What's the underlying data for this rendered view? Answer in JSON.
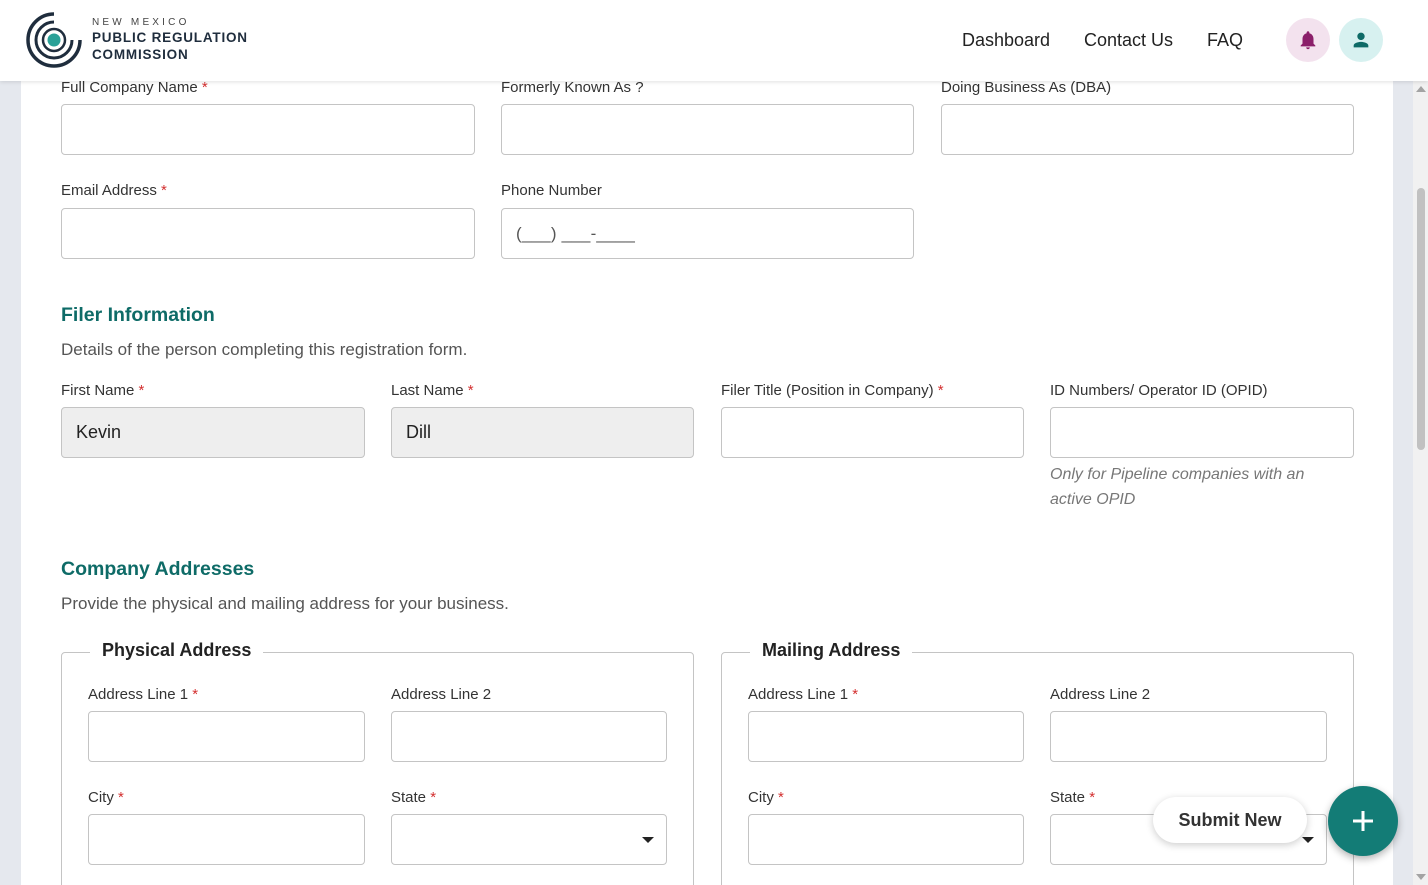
{
  "header": {
    "logo": {
      "line1": "NEW MEXICO",
      "line2": "PUBLIC REGULATION",
      "line3": "COMMISSION"
    },
    "nav": [
      "Dashboard",
      "Contact Us",
      "FAQ"
    ],
    "icons": {
      "bell": "bell-icon",
      "user": "user-icon"
    }
  },
  "company": {
    "full_name_label": "Full Company Name",
    "fka_label": "Formerly Known As ?",
    "dba_label": "Doing Business As (DBA)",
    "email_label": "Email Address",
    "phone_label": "Phone Number",
    "phone_mask": "(___) ___-____"
  },
  "filer": {
    "title": "Filer Information",
    "subtitle": "Details of the person completing this registration form.",
    "first_name_label": "First Name",
    "first_name_value": "Kevin",
    "last_name_label": "Last Name",
    "last_name_value": "Dill",
    "title_label": "Filer Title (Position in Company)",
    "opid_label": "ID Numbers/ Operator ID (OPID)",
    "opid_hint": "Only for Pipeline companies with an active OPID"
  },
  "addresses": {
    "title": "Company Addresses",
    "subtitle": "Provide the physical and mailing address for your business.",
    "physical": {
      "legend": "Physical Address",
      "line1": "Address Line 1",
      "line2": "Address Line 2",
      "city": "City",
      "state": "State"
    },
    "mailing": {
      "legend": "Mailing Address",
      "line1": "Address Line 1",
      "line2": "Address Line 2",
      "city": "City",
      "state": "State"
    }
  },
  "required_mark": "*",
  "floating": {
    "submit_label": "Submit New",
    "fab_icon": "plus-icon"
  },
  "colors": {
    "accent": "#0e6b67",
    "fab": "#137c76",
    "required": "#d32f2f",
    "bell_bg": "#f3e2ee",
    "user_bg": "#d7f1f0"
  }
}
